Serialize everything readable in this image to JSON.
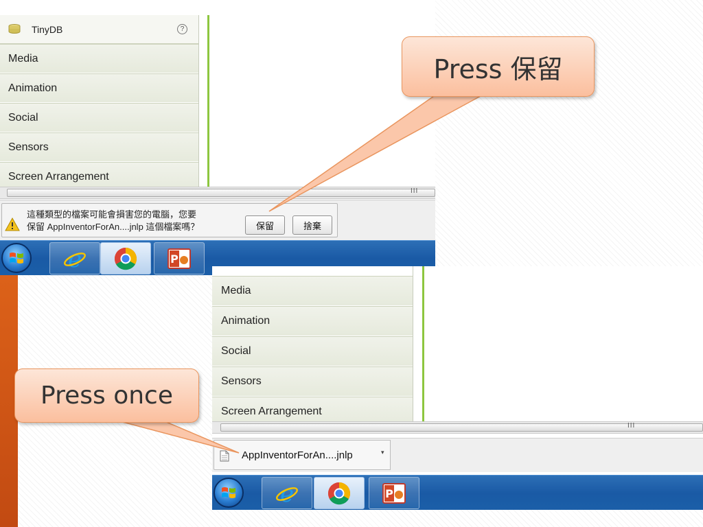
{
  "top_screenshot": {
    "palette_header": {
      "label": "TinyDB",
      "help_glyph": "?"
    },
    "palette_items": [
      {
        "label": "Media"
      },
      {
        "label": "Animation"
      },
      {
        "label": "Social"
      },
      {
        "label": "Sensors"
      },
      {
        "label": "Screen Arrangement"
      }
    ],
    "scrollbar_grip": "III",
    "security_warning": {
      "line1": "這種類型的檔案可能會損害您的電腦，您要",
      "line2": "保留 AppInventorForAn....jnlp 這個檔案嗎？",
      "keep_button": "保留",
      "discard_button": "捨棄"
    },
    "taskbar": {
      "items": [
        "start-orb",
        "internet-explorer-icon",
        "chrome-icon",
        "powerpoint-icon"
      ],
      "active": "chrome-icon"
    }
  },
  "bottom_screenshot": {
    "palette_items": [
      {
        "label": "Media"
      },
      {
        "label": "Animation"
      },
      {
        "label": "Social"
      },
      {
        "label": "Sensors"
      },
      {
        "label": "Screen Arrangement"
      }
    ],
    "scrollbar_grip": "III",
    "download": {
      "filename": "AppInventorForAn....jnlp",
      "menu_arrow": "▾"
    },
    "taskbar": {
      "items": [
        "start-orb",
        "internet-explorer-icon",
        "chrome-icon",
        "powerpoint-icon"
      ],
      "active": "chrome-icon"
    }
  },
  "callouts": {
    "keep": "Press 保留",
    "once": "Press once"
  },
  "colors": {
    "accent_orange": "#e0651a",
    "callout_fill": "#fbbf9e",
    "palette_green_line": "#8dc63f",
    "taskbar_blue": "#1a5aa5"
  }
}
